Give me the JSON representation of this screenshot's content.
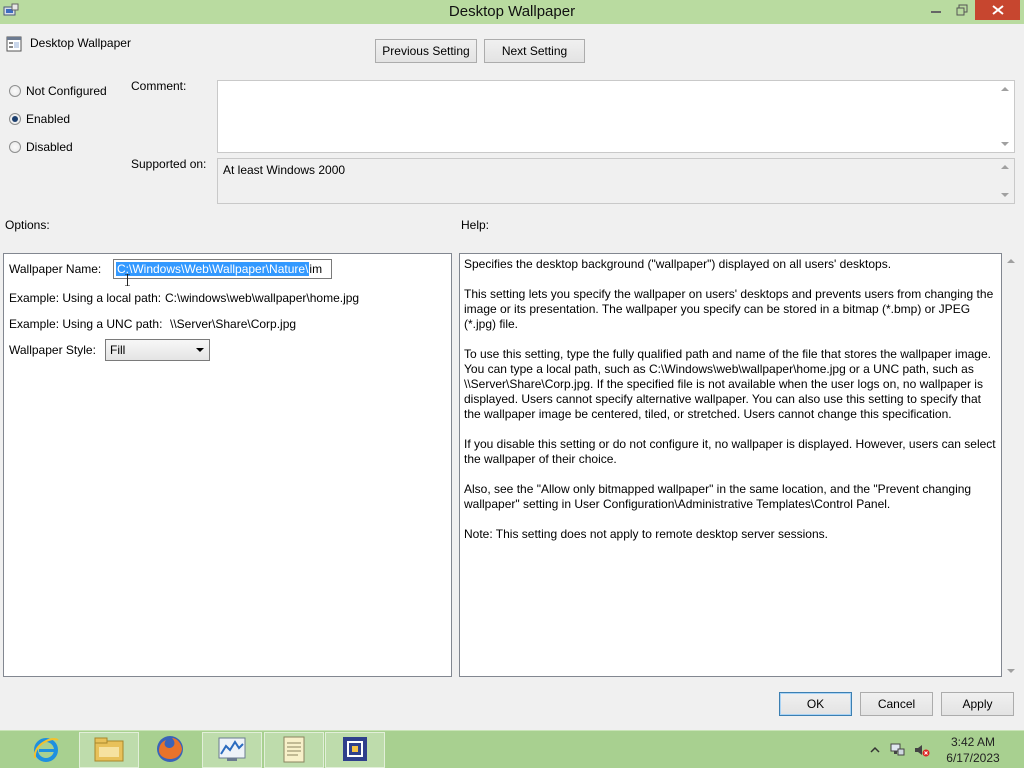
{
  "window": {
    "title": "Desktop Wallpaper",
    "icons": {
      "app": "group-policy-editor-icon",
      "minimize": "minimize-icon",
      "maximize": "restore-icon",
      "close": "close-icon"
    }
  },
  "policy": {
    "name": "Desktop Wallpaper",
    "icon": "policy-setting-icon"
  },
  "nav": {
    "previous": "Previous Setting",
    "next": "Next Setting"
  },
  "state": {
    "options": [
      {
        "label": "Not Configured",
        "checked": false
      },
      {
        "label": "Enabled",
        "checked": true
      },
      {
        "label": "Disabled",
        "checked": false
      }
    ]
  },
  "comment": {
    "label": "Comment:",
    "value": ""
  },
  "supported": {
    "label": "Supported on:",
    "value": "At least Windows 2000"
  },
  "options_section": {
    "label": "Options:",
    "wallpaper_name_label": "Wallpaper Name:",
    "wallpaper_name_selected": "C:\\Windows\\Web\\Wallpaper\\Nature\\",
    "wallpaper_name_rest": "im",
    "example_local_label": "Example: Using a local path:",
    "example_local_value": "C:\\windows\\web\\wallpaper\\home.jpg",
    "example_unc_label": "Example: Using a UNC path:",
    "example_unc_value": "\\\\Server\\Share\\Corp.jpg",
    "style_label": "Wallpaper Style:",
    "style_value": "Fill"
  },
  "help_section": {
    "label": "Help:",
    "paragraphs": [
      "Specifies the desktop background (\"wallpaper\") displayed on all users' desktops.",
      "This setting lets you specify the wallpaper on users' desktops and prevents users from changing the image or its presentation. The wallpaper you specify can be stored in a bitmap (*.bmp) or JPEG (*.jpg) file.",
      "To use this setting, type the fully qualified path and name of the file that stores the wallpaper image. You can type a local path, such as C:\\Windows\\web\\wallpaper\\home.jpg or a UNC path, such as \\\\Server\\Share\\Corp.jpg. If the specified file is not available when the user logs on, no wallpaper is displayed. Users cannot specify alternative wallpaper. You can also use this setting to specify that the wallpaper image be centered, tiled, or stretched. Users cannot change this specification.",
      "If you disable this setting or do not configure it, no wallpaper is displayed. However, users can select the wallpaper of their choice.",
      "Also, see the \"Allow only bitmapped wallpaper\" in the same location, and the \"Prevent changing wallpaper\" setting in User Configuration\\Administrative Templates\\Control Panel.",
      "Note: This setting does not apply to remote desktop server sessions."
    ]
  },
  "footer": {
    "ok": "OK",
    "cancel": "Cancel",
    "apply": "Apply"
  },
  "taskbar": {
    "items": [
      {
        "icon": "internet-explorer-icon",
        "active": false
      },
      {
        "icon": "file-explorer-icon",
        "active": true
      },
      {
        "icon": "firefox-icon",
        "active": false
      },
      {
        "icon": "performance-monitor-icon",
        "active": true
      },
      {
        "icon": "notepad-icon",
        "active": true
      },
      {
        "icon": "virtualbox-icon",
        "active": true
      }
    ],
    "tray": [
      "show-hidden-icons-icon",
      "network-icon",
      "volume-muted-icon"
    ],
    "time": "3:42 AM",
    "date": "6/17/2023"
  }
}
